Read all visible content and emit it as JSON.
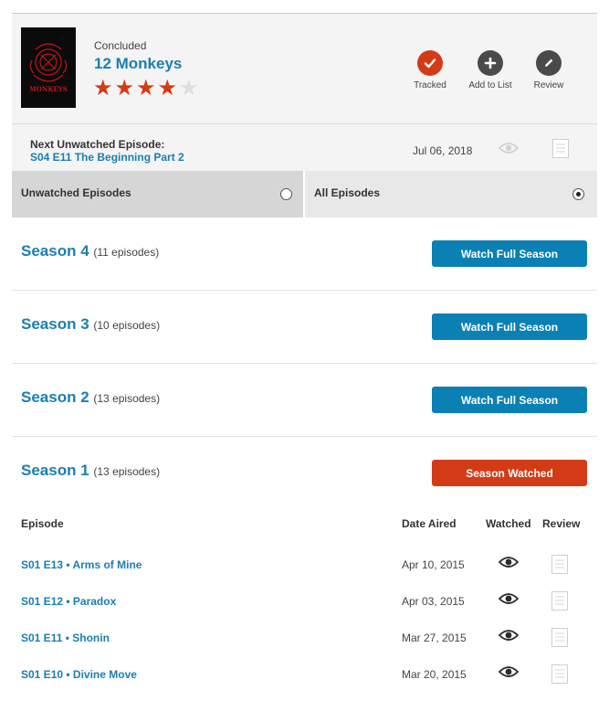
{
  "show": {
    "status": "Concluded",
    "title": "12 Monkeys",
    "rating": 4,
    "rating_max": 5,
    "poster_text": "MONKEYS"
  },
  "actions": [
    {
      "label": "Tracked",
      "icon": "checkmark-icon",
      "color": "#d33b16"
    },
    {
      "label": "Add to List",
      "icon": "plus-icon",
      "color": "#4a4a4a"
    },
    {
      "label": "Review",
      "icon": "pencil-icon",
      "color": "#4a4a4a"
    }
  ],
  "next_unwatched": {
    "label": "Next Unwatched Episode:",
    "episode": "S04 E11 The Beginning Part 2",
    "date": "Jul 06, 2018"
  },
  "filters": {
    "unwatched": "Unwatched Episodes",
    "all": "All Episodes",
    "selected": "all"
  },
  "seasons": [
    {
      "title": "Season 4",
      "count": "(11 episodes)",
      "button": "Watch Full Season",
      "watched": false
    },
    {
      "title": "Season 3",
      "count": "(10 episodes)",
      "button": "Watch Full Season",
      "watched": false
    },
    {
      "title": "Season 2",
      "count": "(13 episodes)",
      "button": "Watch Full Season",
      "watched": false
    },
    {
      "title": "Season 1",
      "count": "(13 episodes)",
      "button": "Season Watched",
      "watched": true
    }
  ],
  "episode_table": {
    "headers": {
      "episode": "Episode",
      "date": "Date Aired",
      "watched": "Watched",
      "review": "Review"
    },
    "rows": [
      {
        "episode": "S01 E13  •  Arms of Mine",
        "date": "Apr 10, 2015"
      },
      {
        "episode": "S01 E12  •  Paradox",
        "date": "Apr 03, 2015"
      },
      {
        "episode": "S01 E11  •  Shonin",
        "date": "Mar 27, 2015"
      },
      {
        "episode": "S01 E10  •  Divine Move",
        "date": "Mar 20, 2015"
      }
    ]
  },
  "colors": {
    "link_blue": "#1a7fb0",
    "watch_button_blue": "#0b80b5",
    "watched_orange": "#d33b16",
    "filter_inactive_bg": "#d6d6d6",
    "filter_active_bg": "#e8e8e8"
  }
}
